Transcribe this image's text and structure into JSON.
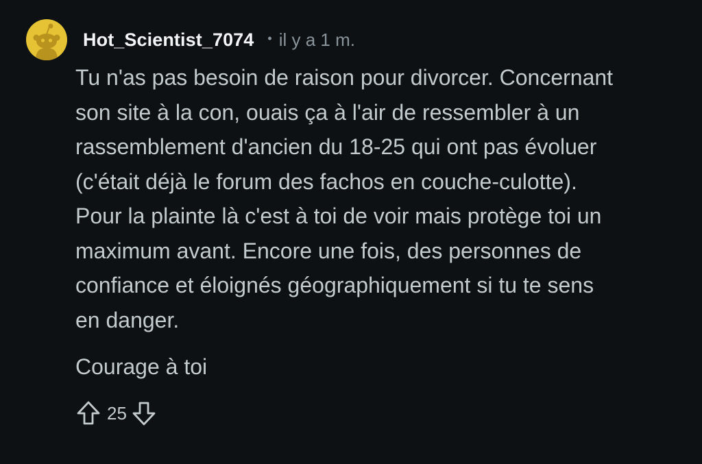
{
  "comment": {
    "author": "Hot_Scientist_7074",
    "separator": "•",
    "time": "il y a 1 m.",
    "paragraph1": "Tu n'as pas besoin de raison pour divorcer. Concernant\nson site à la con, ouais ça à l'air de ressembler à un\nrassemblement d'ancien du 18-25 qui ont pas évoluer\n(c'était déjà le forum des fachos en couche-culotte).\nPour la plainte là c'est à toi de voir mais protège toi un\nmaximum avant. Encore une fois, des personnes de\nconfiance et éloignés géographiquement si tu te sens\nen danger.",
    "paragraph2": "Courage à toi",
    "vote_count": "25"
  },
  "icons": {
    "avatar": "snoo-avatar-icon",
    "upvote": "upvote-arrow-icon",
    "downvote": "downvote-arrow-icon"
  },
  "colors": {
    "background": "#0d1114",
    "avatar_bg": "#e5c334",
    "username": "#f2f4f5",
    "body_text": "#c4cbcf",
    "meta_text": "#8a949b"
  }
}
